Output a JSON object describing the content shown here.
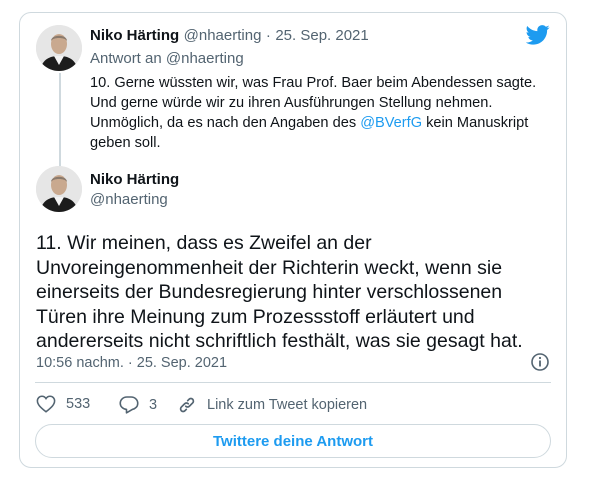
{
  "parent_tweet": {
    "author_name": "Niko Härting",
    "handle": "@nhaerting",
    "separator": "·",
    "date": "25. Sep. 2021",
    "reply_prefix": "Antwort an",
    "reply_handle": "@nhaerting",
    "text_before_mention": "10. Gerne wüssten wir, was Frau Prof. Baer beim Abendessen sagte. Und gerne würde wir zu ihren Ausführungen Stellung nehmen. Unmöglich, da es nach den Angaben des ",
    "mention": "@BVerfG",
    "text_after_mention": " kein Manuskript geben soll."
  },
  "main_tweet": {
    "author_name": "Niko Härting",
    "handle": "@nhaerting",
    "text": "11. Wir meinen, dass es Zweifel an der Unvoreingenommenheit der Richterin weckt, wenn sie einerseits der Bundesregierung hinter verschlossenen Türen ihre Meinung zum Prozessstoff erläutert und andererseits nicht schriftlich festhält, was sie gesagt hat.",
    "timestamp": "10:56 nachm. · 25. Sep. 2021"
  },
  "actions": {
    "likes": "533",
    "replies": "3",
    "copy_link_label": "Link zum Tweet kopieren"
  },
  "reply_button_label": "Twittere deine Antwort",
  "colors": {
    "accent": "#1d9bf0",
    "secondary_text": "#536471",
    "border": "#cfd9de"
  },
  "icons": [
    "twitter-bird-icon",
    "info-icon",
    "heart-icon",
    "reply-icon",
    "link-icon"
  ]
}
